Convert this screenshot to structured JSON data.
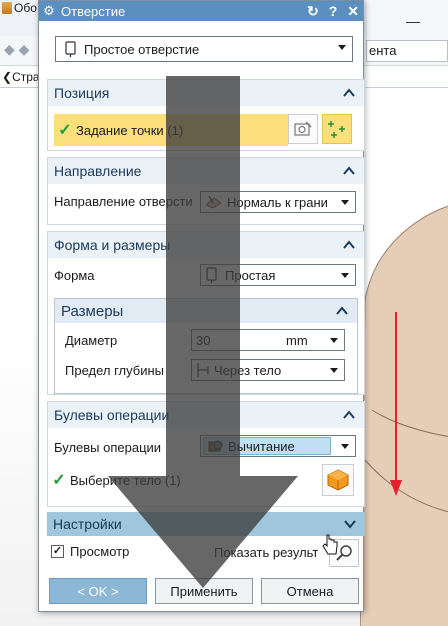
{
  "background": {
    "title_fragment": "Обо",
    "dropdown_text": "ента",
    "tab_label": "Стра"
  },
  "dialog": {
    "title": "Отверстие",
    "title_buttons": {
      "reset": "↻",
      "help": "?",
      "close": "✕"
    },
    "hole_type": "Простое отверстие",
    "sections": {
      "position": {
        "header": "Позиция",
        "selection_label": "Задание точки (1)"
      },
      "direction": {
        "header": "Направление",
        "label": "Направление отверсти",
        "value": "Нормаль к грани"
      },
      "form": {
        "header": "Форма и размеры",
        "shape_label": "Форма",
        "shape_value": "Простая",
        "dimensions": {
          "header": "Размеры",
          "diameter_label": "Диаметр",
          "diameter_value": "30",
          "diameter_unit": "mm",
          "depth_limit_label": "Предел глубины",
          "depth_limit_value": "Через тело"
        }
      },
      "boolean": {
        "header": "Булевы операции",
        "label": "Булевы операции",
        "value": "Вычитание",
        "select_body_label": "Выберите тело (1)"
      },
      "settings": {
        "header": "Настройки"
      }
    },
    "preview_label": "Просмотр",
    "show_result_label": "Показать результ",
    "buttons": {
      "ok": "< OK >",
      "apply": "Применить",
      "cancel": "Отмена"
    }
  },
  "colors": {
    "title_bar": "#5b8fc0",
    "selection_highlight": "#fbdf7a",
    "settings_bar": "#9fc6dc",
    "ok_button": "#8cb7d6",
    "check_green": "#1f9d3a",
    "annotation_arrow": "#e8202a"
  }
}
